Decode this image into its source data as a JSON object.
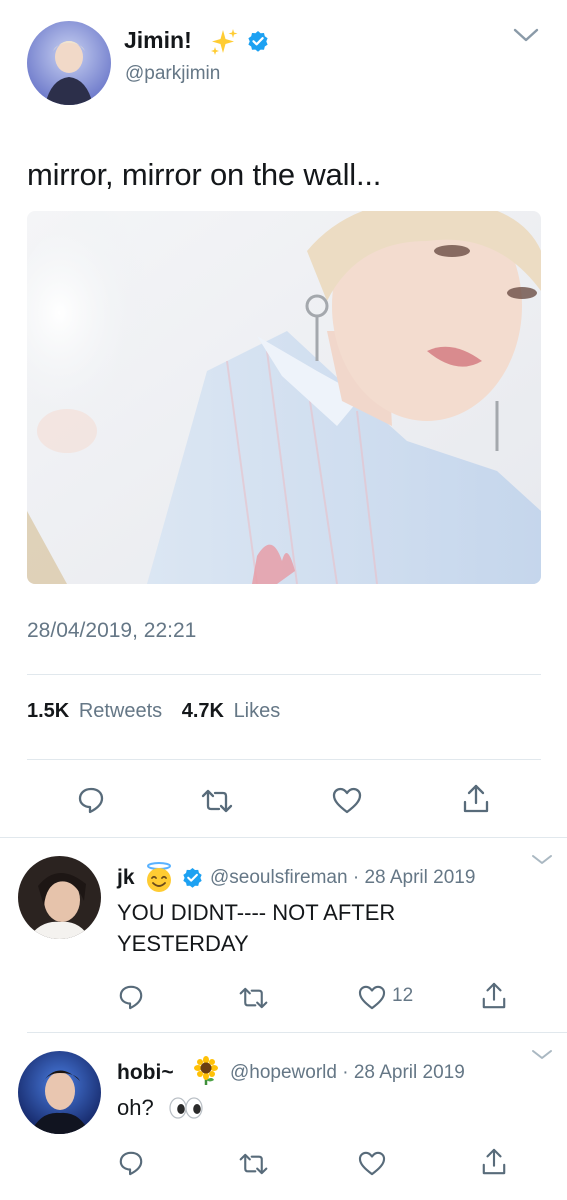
{
  "tweet": {
    "display_name": "Jimin!",
    "name_emoji": "sparkles",
    "handle": "@parkjimin",
    "verified": true,
    "text": "mirror, mirror on the wall...",
    "timestamp": "28/04/2019, 22:21",
    "retweet_count": "1.5K",
    "retweet_label": "Retweets",
    "like_count": "4.7K",
    "like_label": "Likes",
    "photo_description_icon": "photo"
  },
  "replies": [
    {
      "display_name": "jk",
      "name_emoji": "smiling-face-with-halo",
      "verified": true,
      "handle": "@seoulsfireman",
      "separator": "·",
      "date": "28 April 2019",
      "text_line1": "YOU DIDNT---- NOT AFTER",
      "text_line2": "YESTERDAY",
      "like_count": "12"
    },
    {
      "display_name": "hobi~",
      "name_emoji": "sunflower",
      "verified": false,
      "handle": "@hopeworld",
      "separator": "·",
      "date": "28 April 2019",
      "text": "oh?",
      "text_emoji": "eyes",
      "like_count": ""
    }
  ],
  "colors": {
    "verified_blue": "#1da1f2",
    "text_dark": "#14171a",
    "text_gray": "#657786",
    "divider": "#e1e8ed"
  },
  "icons": [
    "chevron-down-icon",
    "reply-icon",
    "retweet-icon",
    "like-icon",
    "share-icon",
    "verified-badge-icon"
  ]
}
